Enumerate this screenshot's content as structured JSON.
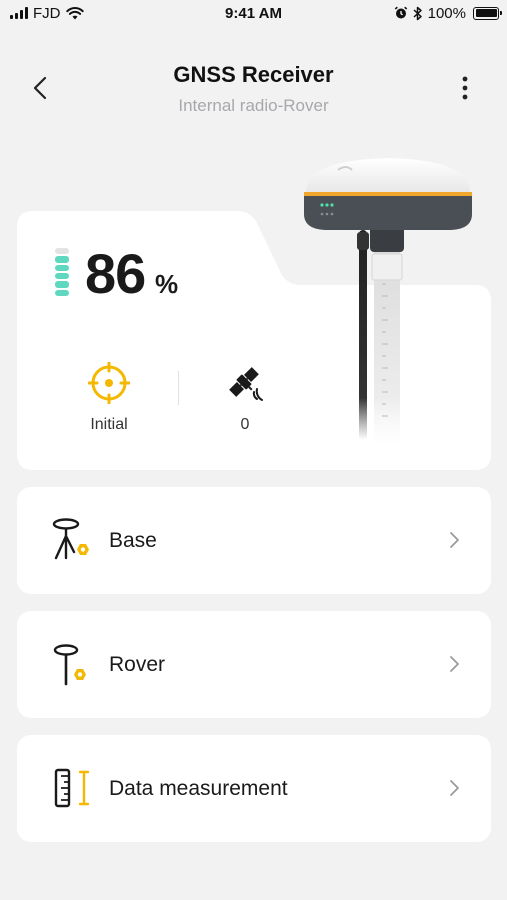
{
  "status_bar": {
    "carrier": "FJD",
    "time": "9:41 AM",
    "battery": "100%"
  },
  "header": {
    "title": "GNSS Receiver",
    "subtitle": "Internal radio-Rover"
  },
  "device": {
    "battery_value": "86",
    "battery_unit": "%",
    "battery_fraction": 0.86,
    "positioning_status": "Initial",
    "satellite_count": "0"
  },
  "menu": [
    {
      "label": "Base",
      "icon": "base-tripod-icon"
    },
    {
      "label": "Rover",
      "icon": "rover-pole-icon"
    },
    {
      "label": "Data measurement",
      "icon": "measurement-ruler-icon"
    }
  ],
  "colors": {
    "accent": "#f5b800",
    "battery_green": "#5ed8be",
    "background": "#f2f2f3",
    "card": "#ffffff"
  }
}
